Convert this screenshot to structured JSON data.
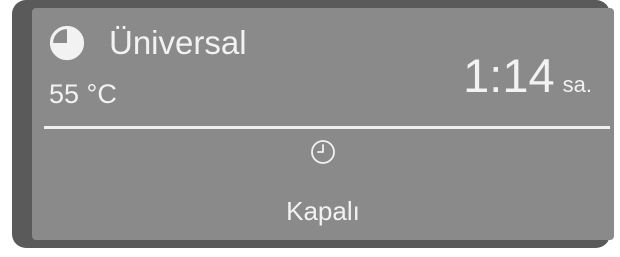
{
  "display": {
    "program_icon": "quarter-pie-icon",
    "program_name": "Üniversal",
    "temperature": "55 °C",
    "remaining_time": "1:14",
    "remaining_unit": "sa.",
    "timer_icon": "clock-icon",
    "timer_status": "Kapalı"
  },
  "colors": {
    "frame": "#5a5a5a",
    "screen_background": "#8a8a8a",
    "text": "#f2f2f2"
  }
}
